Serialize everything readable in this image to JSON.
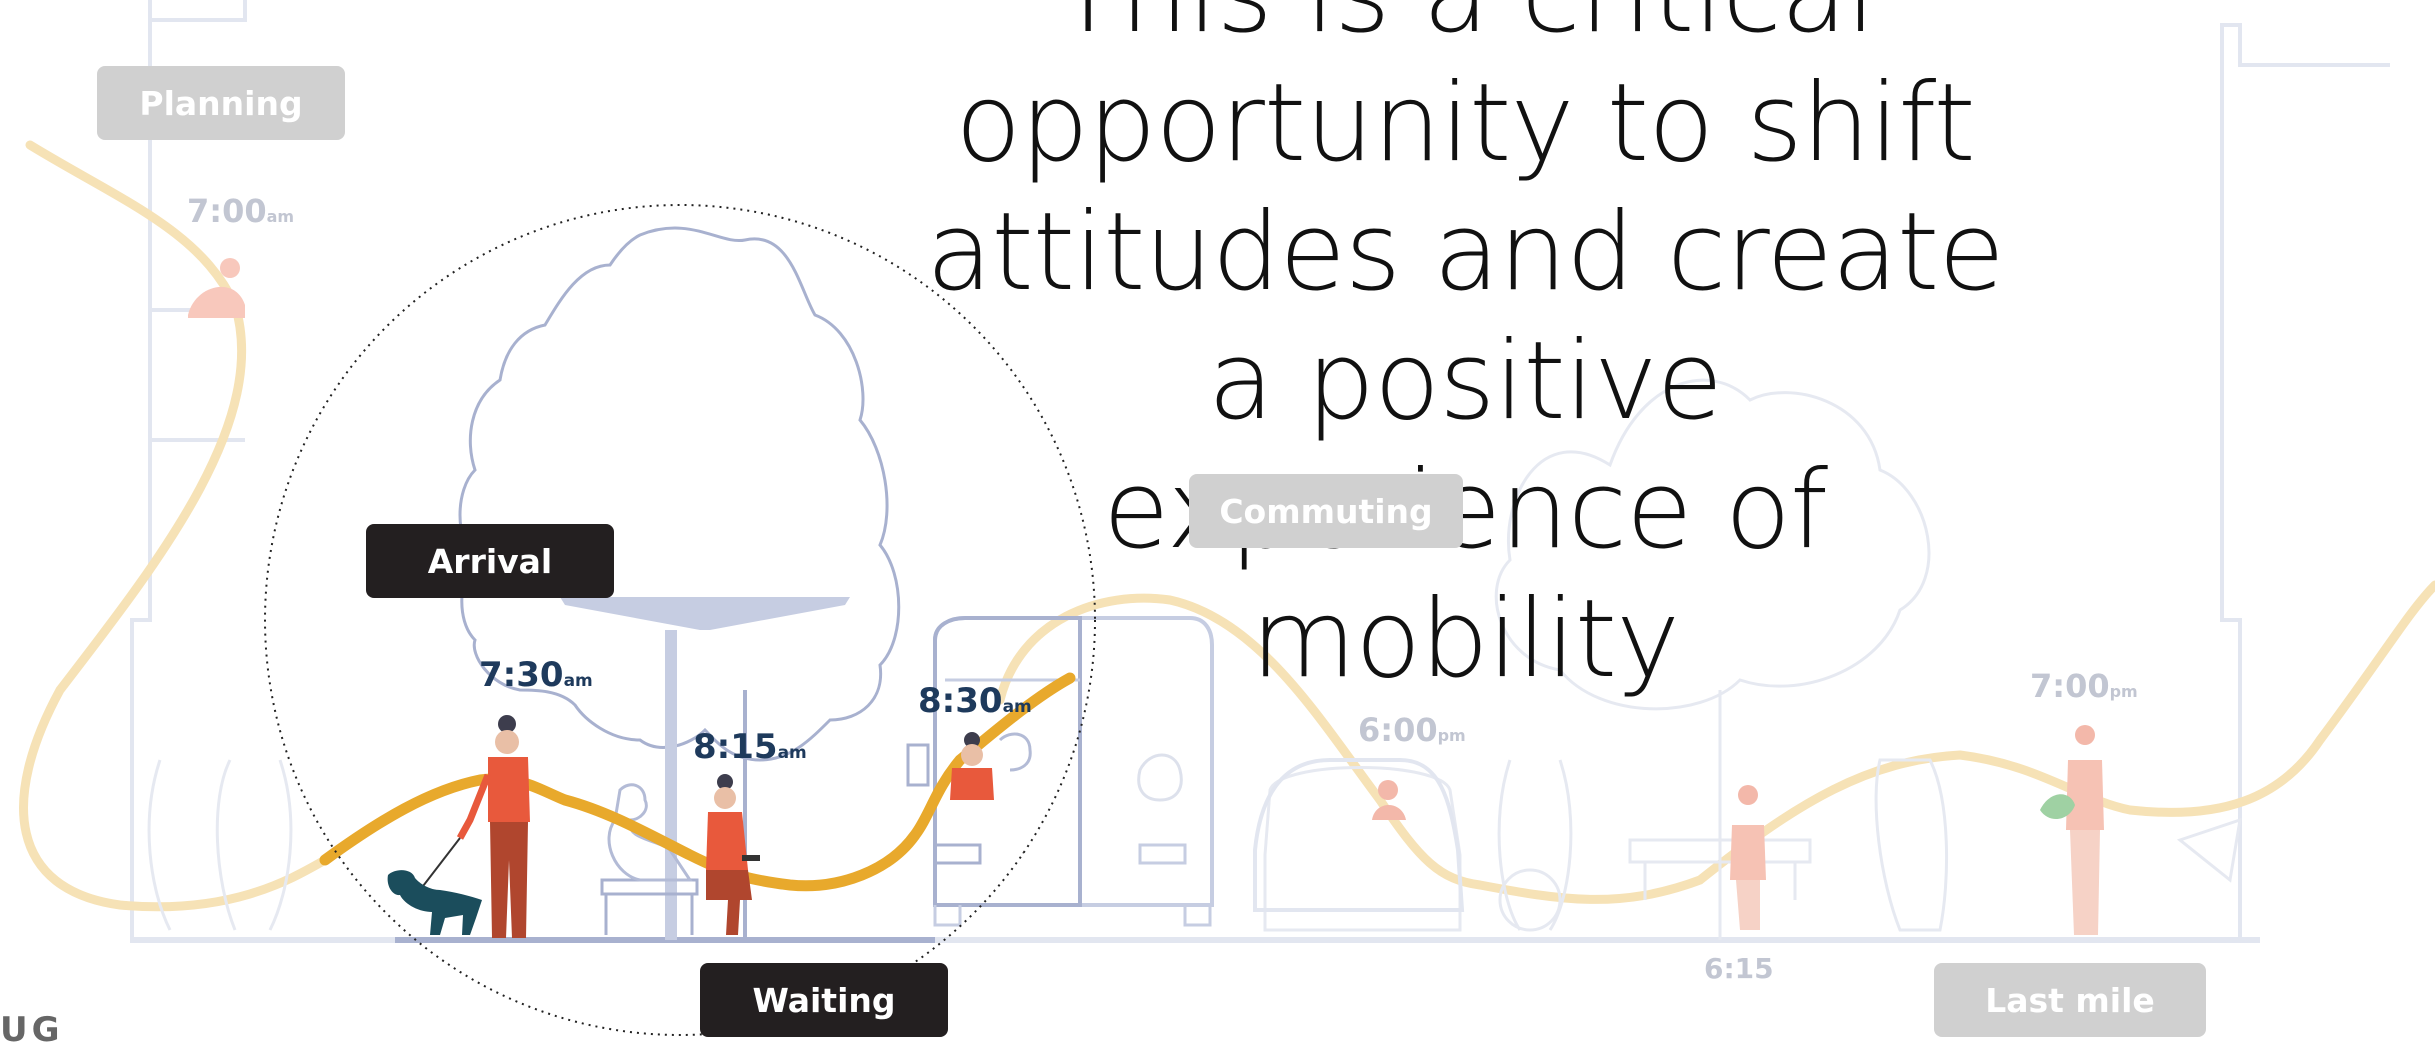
{
  "headline": "This is a critical opportunity to shift attitudes and create a positive experience of mobility",
  "stages": {
    "planning": "Planning",
    "arrival": "Arrival",
    "commuting": "Commuting",
    "waiting": "Waiting",
    "last_mile": "Last mile"
  },
  "times": {
    "t700am": {
      "time": "7:00",
      "suffix": "am"
    },
    "t730am": {
      "time": "7:30",
      "suffix": "am"
    },
    "t815am": {
      "time": "8:15",
      "suffix": "am"
    },
    "t830am": {
      "time": "8:30",
      "suffix": "am"
    },
    "t600pm": {
      "time": "6:00",
      "suffix": "pm"
    },
    "t700pm": {
      "time": "7:00",
      "suffix": "pm"
    },
    "t615": {
      "time": "6:15",
      "suffix": ""
    }
  },
  "logo_fragment": "UG",
  "colors": {
    "path": "#e8a92c",
    "path_faded": "#f6e2b6",
    "person_top": "#e8593c",
    "person_bottom": "#b0462e",
    "line": "#a8b1cf",
    "line_faded": "#e2e6f0",
    "dog": "#1b4d5c",
    "tag_dark": "#231f20",
    "tag_faded": "#d0d0d0"
  }
}
